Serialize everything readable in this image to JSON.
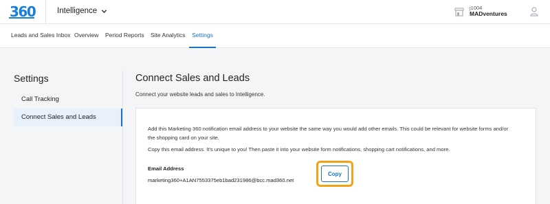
{
  "header": {
    "logo_text": "360",
    "app_name": "Intelligence",
    "account_id": "j1004",
    "account_name": "MADventures",
    "colors": {
      "brand": "#1a7fd8",
      "accent": "#1a73c8",
      "highlight": "#f2a313"
    }
  },
  "nav": {
    "tabs": [
      {
        "label": "Leads and Sales Inbox",
        "active": false
      },
      {
        "label": "Overview",
        "active": false
      },
      {
        "label": "Period Reports",
        "active": false
      },
      {
        "label": "Site Analytics",
        "active": false
      },
      {
        "label": "Settings",
        "active": true
      }
    ]
  },
  "sidebar": {
    "title": "Settings",
    "items": [
      {
        "label": "Call Tracking",
        "active": false
      },
      {
        "label": "Connect Sales and Leads",
        "active": true
      }
    ]
  },
  "main": {
    "title": "Connect Sales and Leads",
    "subtitle": "Connect your website leads and sales to Intelligence.",
    "card": {
      "paragraph1": "Add this Marketing 360 notification email address to your website the same way you would add other emails. This could be relevant for website forms and/or the shopping card on your site.",
      "paragraph2": "Copy this email address. It's unique to you! Then paste it into your website form notifications, shopping cart notifications, and more.",
      "email_label": "Email Address",
      "email_value": "marketing360+A1AN7553375eb1bad231986@bcc.mad360.net",
      "copy_label": "Copy"
    }
  },
  "icons": {
    "logo": "m360-logo",
    "app_dropdown": "chevron-down-icon",
    "store": "store-icon",
    "user": "user-icon"
  }
}
